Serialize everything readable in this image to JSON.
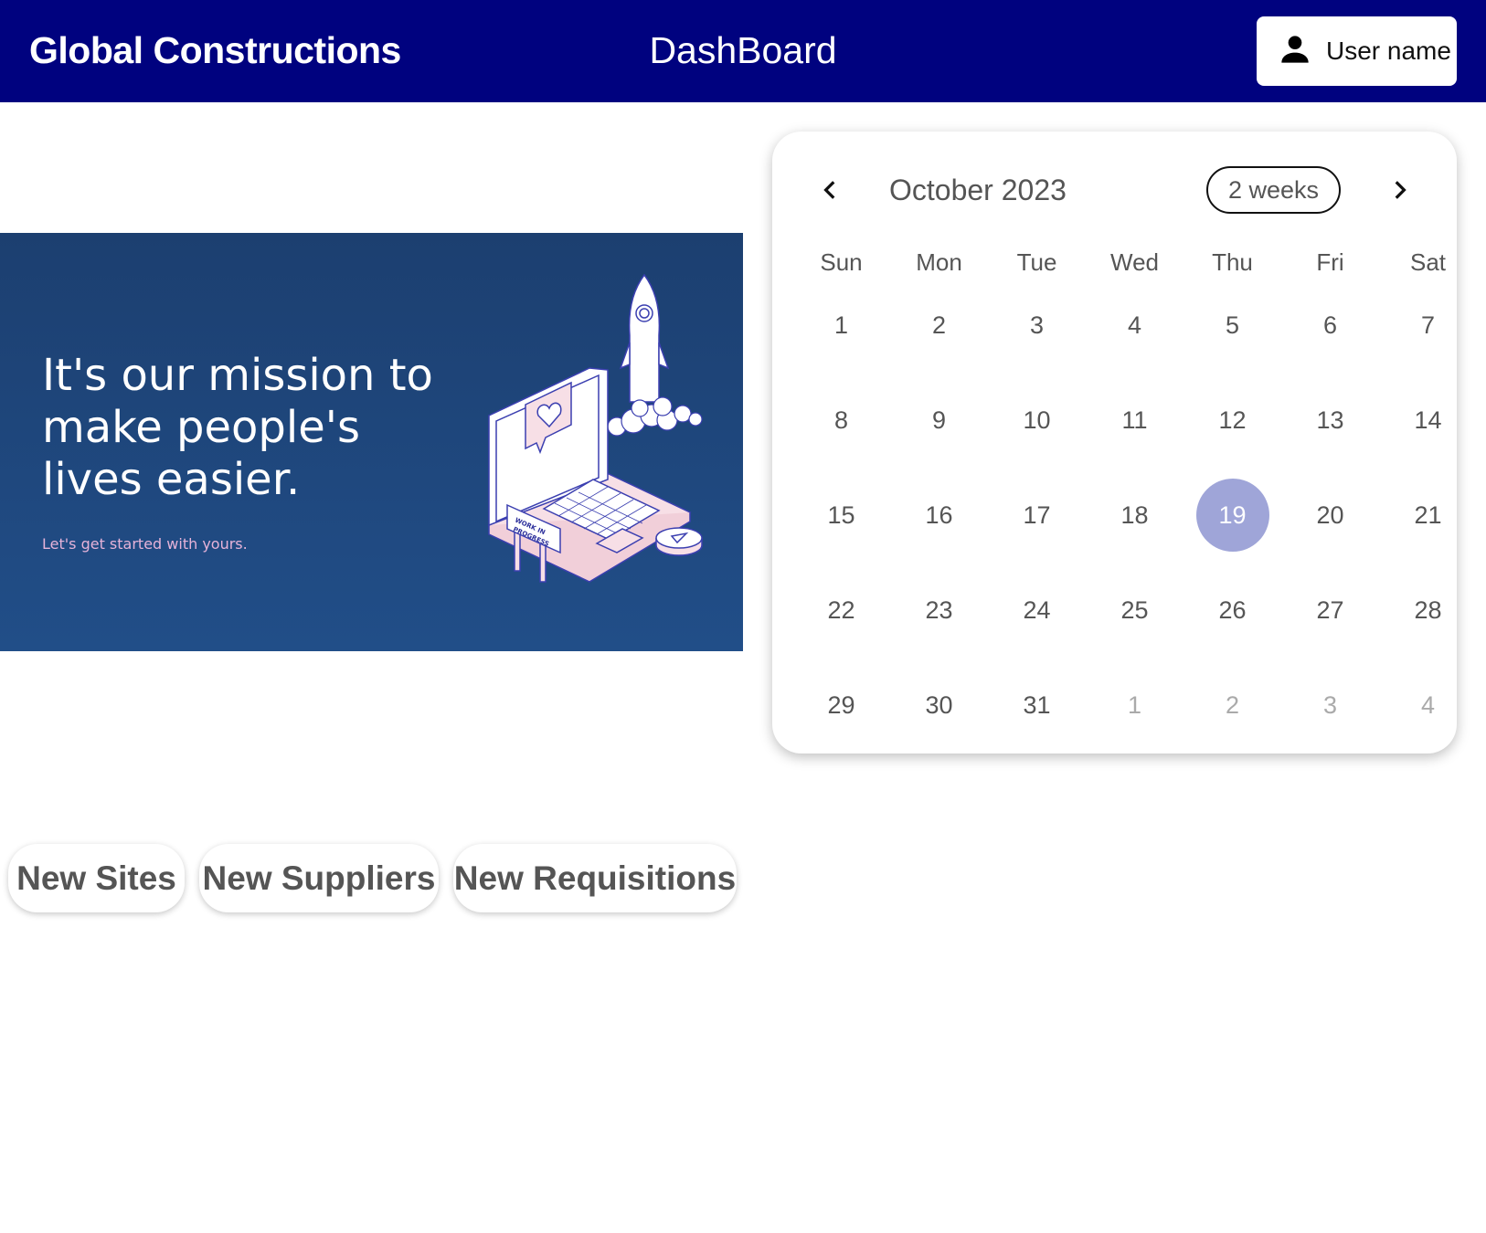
{
  "header": {
    "brand": "Global Constructions",
    "title": "DashBoard",
    "user_label": "User name",
    "user_icon": "person-icon"
  },
  "banner": {
    "headline": "It's our mission to make people's lives easier.",
    "subtitle": "Let's get started with yours.",
    "sign_text_line1": "WORK IN",
    "sign_text_line2": "PROGRESS"
  },
  "calendar": {
    "title": "October 2023",
    "format_button": "2 weeks",
    "prev_icon": "chevron-left-icon",
    "next_icon": "chevron-right-icon",
    "weekdays": [
      "Sun",
      "Mon",
      "Tue",
      "Wed",
      "Thu",
      "Fri",
      "Sat"
    ],
    "weeks": [
      [
        "1",
        "2",
        "3",
        "4",
        "5",
        "6",
        "7"
      ],
      [
        "8",
        "9",
        "10",
        "11",
        "12",
        "13",
        "14"
      ],
      [
        "15",
        "16",
        "17",
        "18",
        "19",
        "20",
        "21"
      ],
      [
        "22",
        "23",
        "24",
        "25",
        "26",
        "27",
        "28"
      ],
      [
        "29",
        "30",
        "31",
        "1",
        "2",
        "3",
        "4"
      ]
    ],
    "selected_day": "19",
    "selected_color": "#9fa5d8"
  },
  "chips": [
    "New Sites",
    "New Suppliers",
    "New Requisitions"
  ],
  "colors": {
    "app_bar": "#00027f",
    "banner": "#1f4a80",
    "banner_subtitle": "#e6b3d9"
  }
}
